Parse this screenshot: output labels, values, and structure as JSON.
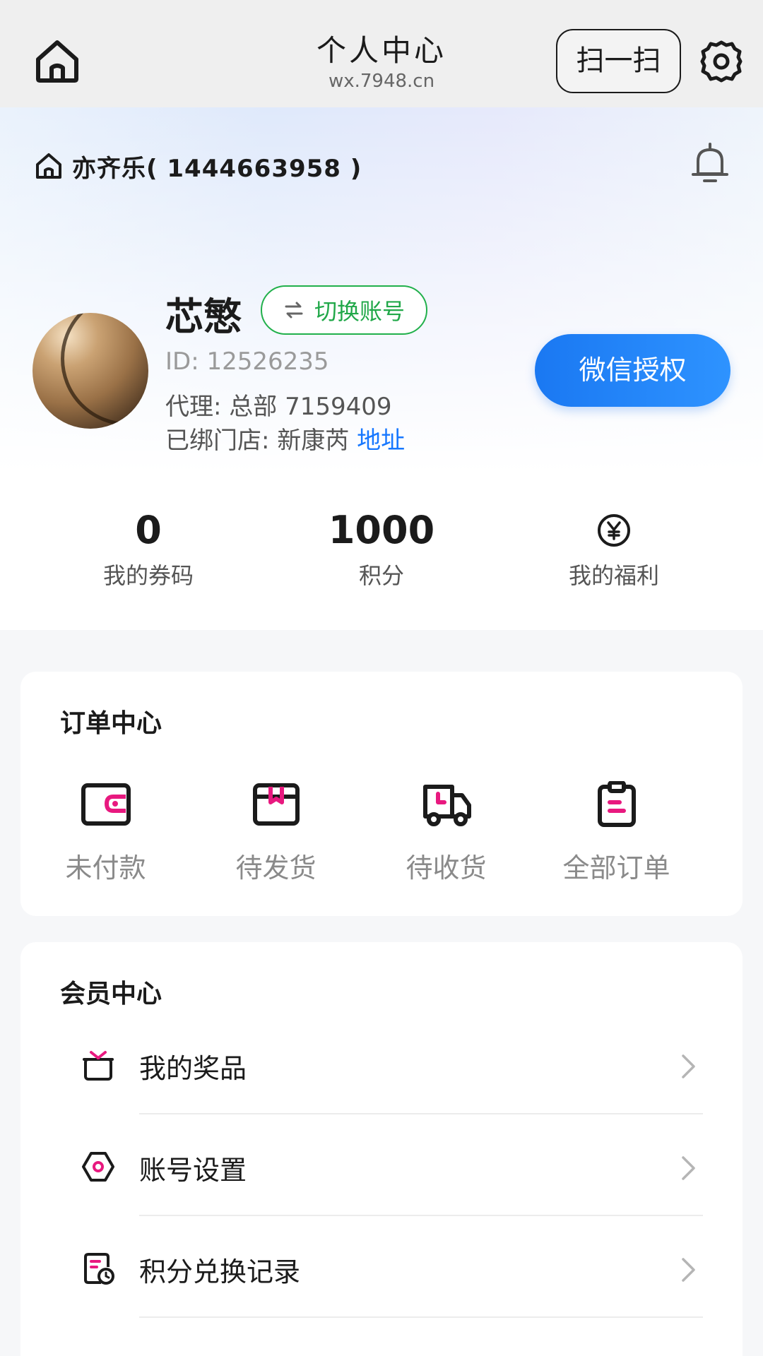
{
  "navbar": {
    "title": "个人中心",
    "url": "wx.7948.cn",
    "scan_label": "扫一扫",
    "home_icon": "home-icon",
    "settings_icon": "gear-icon"
  },
  "shop": {
    "name": "亦齐乐( 1444663958 )",
    "icon": "home-icon",
    "notification_icon": "bell-icon"
  },
  "user": {
    "name": "芯慜",
    "switch_label": "切换账号",
    "id_text": "ID: 12526235",
    "agent_text": "代理: 总部 7159409",
    "store_prefix": "已绑门店: 新康芮",
    "store_link": "地址",
    "wechat_button": "微信授权"
  },
  "stats": [
    {
      "value": "0",
      "label": "我的券码"
    },
    {
      "value": "1000",
      "label": "积分"
    },
    {
      "icon": "yen-coin-icon",
      "label": "我的福利"
    }
  ],
  "order_center": {
    "title": "订单中心",
    "items": [
      {
        "label": "未付款",
        "icon": "wallet-icon"
      },
      {
        "label": "待发货",
        "icon": "box-icon"
      },
      {
        "label": "待收货",
        "icon": "truck-icon"
      },
      {
        "label": "全部订单",
        "icon": "clipboard-icon"
      }
    ]
  },
  "member_center": {
    "title": "会员中心",
    "items": [
      {
        "label": "我的奖品",
        "icon": "gift-icon"
      },
      {
        "label": "账号设置",
        "icon": "hexagon-settings-icon"
      },
      {
        "label": "积分兑换记录",
        "icon": "history-icon"
      }
    ]
  },
  "colors": {
    "accent_blue": "#1677ff",
    "accent_green": "#21b04b",
    "accent_pink": "#e8197f"
  }
}
